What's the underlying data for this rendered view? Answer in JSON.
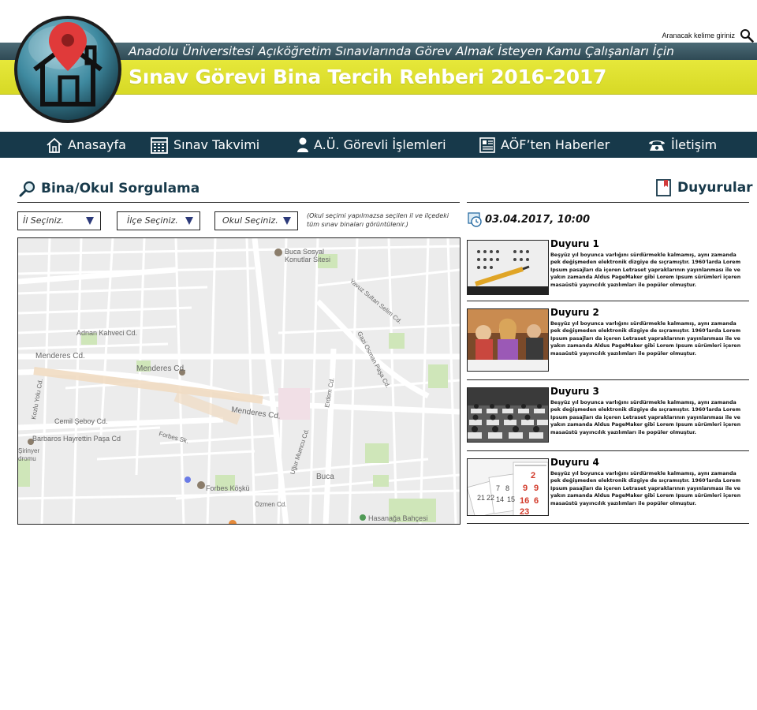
{
  "header": {
    "search_label": "Aranacak kelime giriniz",
    "subtitle": "Anadolu Üniversitesi Açıköğretim Sınavlarında Görev Almak İsteyen Kamu Çalışanları İçin",
    "title": "Sınav Görevi Bina Tercih Rehberi 2016-2017"
  },
  "nav": [
    {
      "label": "Anasayfa",
      "icon": "home-icon"
    },
    {
      "label": "Sınav Takvimi",
      "icon": "calendar-icon"
    },
    {
      "label": "A.Ü. Görevli İşlemleri",
      "icon": "user-icon"
    },
    {
      "label": "AÖF’ten Haberler",
      "icon": "newspaper-icon"
    },
    {
      "label": "İletişim",
      "icon": "phone-icon"
    }
  ],
  "query": {
    "title": "Bina/Okul Sorgulama",
    "selects": [
      "İl Seçiniz.",
      "İlçe Seçiniz.",
      "Okul Seçiniz."
    ],
    "note": "(Okul seçimi yapılmazsa seçilen il ve ilçedeki tüm sınav binaları görüntülenir.)"
  },
  "map": {
    "labels": [
      {
        "text": "Buca Sosyal"
      },
      {
        "text": "Konutlar Sitesi"
      },
      {
        "text": "Menderes Cd."
      },
      {
        "text": "Menderes Cd."
      },
      {
        "text": "Menderes Cd."
      },
      {
        "text": "Barbaros Hayrettin Paşa Cd"
      },
      {
        "text": "Cemil Şeboy Cd."
      },
      {
        "text": "Adnan Kahveci Cd."
      },
      {
        "text": "Forbes Köşkü"
      },
      {
        "text": "Buca"
      },
      {
        "text": "Hasanağa Bahçesi"
      },
      {
        "text": "Gazi Osman Paşa Cd."
      },
      {
        "text": "Erdem Cd."
      },
      {
        "text": "Özmen Cd."
      },
      {
        "text": "Forbes Sk."
      },
      {
        "text": "Uğur Mumcu Cd."
      },
      {
        "text": "Şirinyer"
      },
      {
        "text": "dromu"
      },
      {
        "text": "Yavuz Sultan Selim Cd."
      },
      {
        "text": "Kozlu Yolu Cd."
      }
    ]
  },
  "announcements": {
    "title": "Duyurular",
    "date": "03.04.2017, 10:00",
    "items": [
      {
        "title": "Duyuru 1",
        "text": "Beşyüz yıl boyunca varlığını sürdürmekle kalmamış, aynı zamanda pek değişmeden elektronik dizgiye de sıçramıştır. 1960'larda Lorem Ipsum pasajları da içeren Letraset yapraklarının yayınlanması ile ve yakın zamanda Aldus PageMaker gibi Lorem Ipsum sürümleri içeren masaüstü yayıncılık yazılımları ile popüler olmuştur."
      },
      {
        "title": "Duyuru 2",
        "text": "Beşyüz yıl boyunca varlığını sürdürmekle kalmamış, aynı zamanda pek değişmeden elektronik dizgiye de sıçramıştır. 1960'larda Lorem Ipsum pasajları da içeren Letraset yapraklarının yayınlanması ile ve yakın zamanda Aldus PageMaker gibi Lorem Ipsum sürümleri içeren masaüstü yayıncılık yazılımları ile popüler olmuştur."
      },
      {
        "title": "Duyuru 3",
        "text": "Beşyüz yıl boyunca varlığını sürdürmekle kalmamış, aynı zamanda pek değişmeden elektronik dizgiye de sıçramıştır. 1960'larda Lorem Ipsum pasajları da içeren Letraset yapraklarının yayınlanması ile ve yakın zamanda Aldus PageMaker gibi Lorem Ipsum sürümleri içeren masaüstü yayıncılık yazılımları ile popüler olmuştur."
      },
      {
        "title": "Duyuru 4",
        "text": "Beşyüz yıl boyunca varlığını sürdürmekle kalmamış, aynı zamanda pek değişmeden elektronik dizgiye de sıçramıştır. 1960'larda Lorem Ipsum pasajları da içeren Letraset yapraklarının yayınlanması ile ve yakın zamanda Aldus PageMaker gibi Lorem Ipsum sürümleri içeren masaüstü yayıncılık yazılımları ile popüler olmuştur."
      }
    ]
  },
  "colors": {
    "nav_bg": "#17394a",
    "banner_yellow": "#e1e330",
    "banner_dark": "#3d5c67",
    "heading": "#17394a"
  }
}
